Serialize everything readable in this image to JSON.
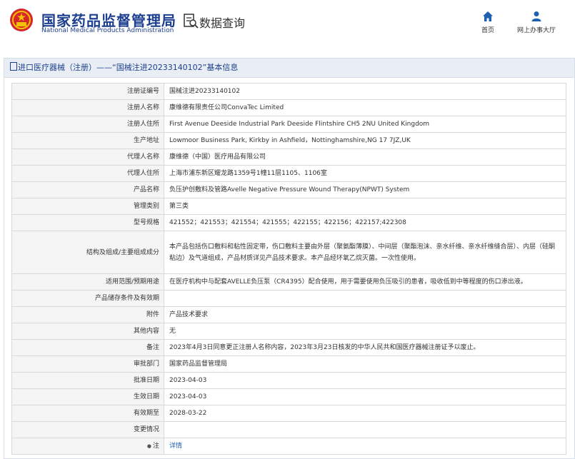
{
  "header": {
    "site_title": "国家药品监督管理局",
    "site_subtitle": "National Medical Products Administration",
    "section_title": "数据查询",
    "nav": [
      {
        "label": "首页",
        "icon": "home-icon"
      },
      {
        "label": "网上办事大厅",
        "icon": "person-icon"
      }
    ]
  },
  "panel": {
    "title": "进口医疗器械（注册）——“国械注进20233140102”基本信息"
  },
  "rows": [
    {
      "label": "注册证编号",
      "value": "国械注进20233140102"
    },
    {
      "label": "注册人名称",
      "value": "康维德有限责任公司ConvaTec Limited"
    },
    {
      "label": "注册人住所",
      "value": "First Avenue Deeside Industrial Park Deeside Flintshire CH5 2NU United Kingdom"
    },
    {
      "label": "生产地址",
      "value": "Lowmoor Business Park, Kirkby in Ashfield，Nottinghamshire,NG 17 7JZ,UK"
    },
    {
      "label": "代理人名称",
      "value": "康维德（中国）医疗用品有限公司"
    },
    {
      "label": "代理人住所",
      "value": "上海市浦东新区耀龙路1359号1幢11层1105、1106室"
    },
    {
      "label": "产品名称",
      "value": "负压护创敷料及管路Avelle Negative Pressure Wound Therapy(NPWT) System"
    },
    {
      "label": "管理类别",
      "value": "第三类"
    },
    {
      "label": "型号规格",
      "value": "421552；421553；421554；421555；422155；422156；422157;422308"
    },
    {
      "label": "结构及组成/主要组成成分",
      "value": "本产品包括伤口敷料和粘性固定带，伤口敷料主要由外层（聚氨酯薄膜）、中间层（聚酯泡沫、亲水纤维、亲水纤维缝合层）、内层（硅酮粘边）及气道组成，产品材质详见产品技术要求。本产品经环氧乙烷灭菌。一次性使用。"
    },
    {
      "label": "适用范围/预期用途",
      "value": "在医疗机构中与配套AVELLE负压泵（CR4395）配合使用，用于需要使用负压吸引的患者，吸收低到中等程度的伤口渗出液。"
    },
    {
      "label": "产品储存条件及有效期",
      "value": ""
    },
    {
      "label": "附件",
      "value": "产品技术要求"
    },
    {
      "label": "其他内容",
      "value": "无"
    },
    {
      "label": "备注",
      "value": "2023年4月3日同意更正注册人名称内容，2023年3月23日核发的中华人民共和国医疗器械注册证予以废止。"
    },
    {
      "label": "审批部门",
      "value": "国家药品监督管理局"
    },
    {
      "label": "批准日期",
      "value": "2023-04-03"
    },
    {
      "label": "生效日期",
      "value": "2023-04-03"
    },
    {
      "label": "有效期至",
      "value": "2028-03-22"
    },
    {
      "label": "变更情况",
      "value": ""
    },
    {
      "label": "注",
      "value": "详情"
    }
  ]
}
